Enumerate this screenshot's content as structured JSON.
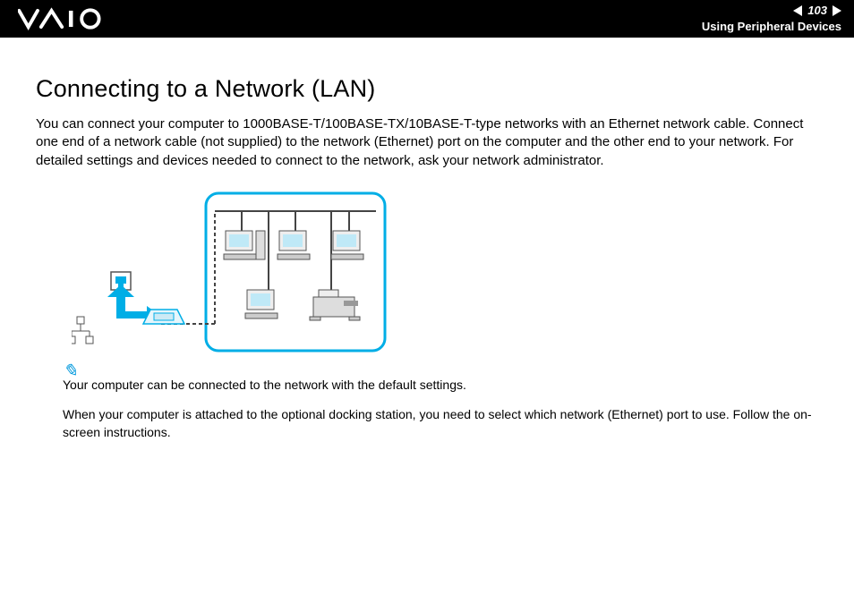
{
  "header": {
    "page_number": "103",
    "section": "Using Peripheral Devices"
  },
  "page": {
    "title": "Connecting to a Network (LAN)",
    "intro": "You can connect your computer to 1000BASE-T/100BASE-TX/10BASE-T-type networks with an Ethernet network cable. Connect one end of a network cable (not supplied) to the network (Ethernet) port on the computer and the other end to your network. For detailed settings and devices needed to connect to the network, ask your network administrator."
  },
  "notes": {
    "line1": "Your computer can be connected to the network with the default settings.",
    "line2": "When your computer is attached to the optional docking station, you need to select which network (Ethernet) port to use. Follow the on-screen instructions."
  },
  "icons": {
    "note": "✎"
  }
}
